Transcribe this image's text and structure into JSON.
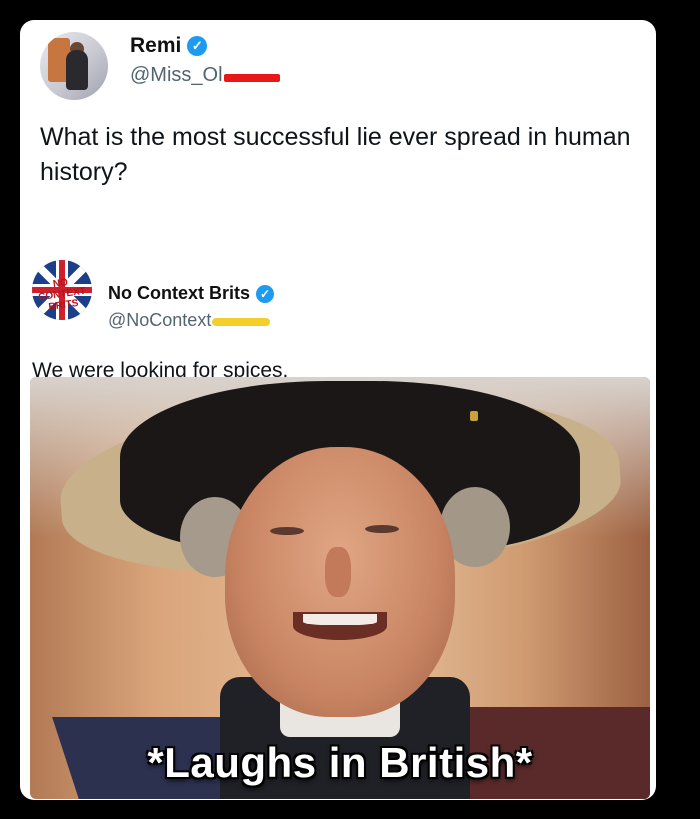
{
  "tweet1": {
    "name": "Remi",
    "handle_visible": "@Miss_Ol",
    "text": "What is the most successful lie ever spread in human history?"
  },
  "tweet2": {
    "name": "No Context Brits",
    "handle_visible": "@NoContext",
    "avatar_text": "NO CONTEXT BRITS",
    "text": "We were looking for spices."
  },
  "meme": {
    "caption": "*Laughs in British*"
  },
  "icons": {
    "verified": "verified-badge-icon"
  },
  "colors": {
    "verified_blue": "#1d9bf0",
    "handle_gray": "#536471",
    "redact_red": "#e81818",
    "redact_yellow": "#f3cf2b"
  }
}
